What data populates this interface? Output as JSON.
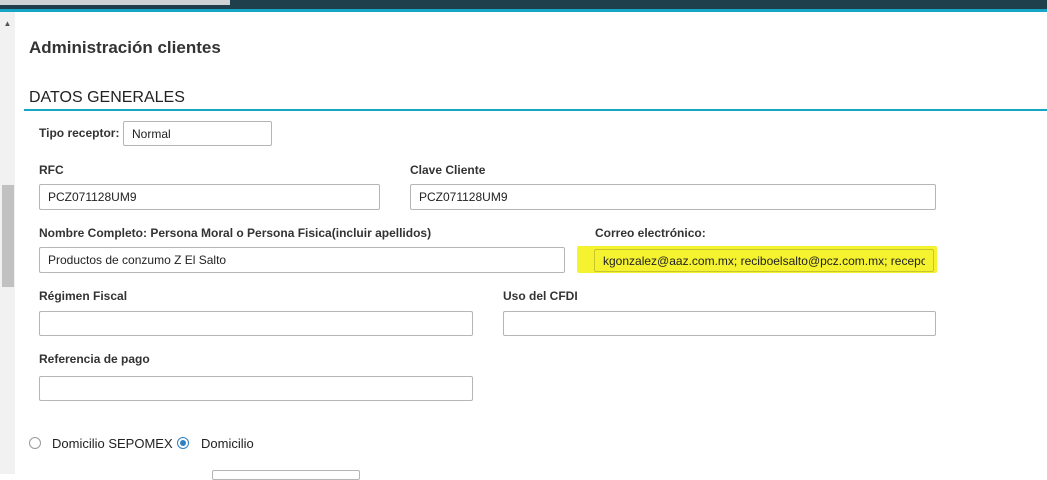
{
  "page": {
    "title": "Administración clientes",
    "section_title": "DATOS GENERALES"
  },
  "form": {
    "tipo_receptor": {
      "label": "Tipo receptor:",
      "value": "Normal"
    },
    "rfc": {
      "label": "RFC",
      "value": "PCZ071128UM9"
    },
    "clave_cliente": {
      "label": "Clave Cliente",
      "value": "PCZ071128UM9"
    },
    "nombre_completo": {
      "label": "Nombre Completo: Persona Moral o Persona Fisica(incluir apellidos)",
      "value": "Productos de conzumo Z El Salto"
    },
    "correo": {
      "label": "Correo electrónico:",
      "value": "kgonzalez@aaz.com.mx; reciboelsalto@pcz.com.mx; recepci"
    },
    "regimen_fiscal": {
      "label": "Régimen Fiscal",
      "value": ""
    },
    "uso_cfdi": {
      "label": "Uso del CFDI",
      "value": ""
    },
    "referencia_pago": {
      "label": "Referencia de pago",
      "value": ""
    }
  },
  "domicilio": {
    "options": [
      {
        "label": "Domicilio SEPOMEX",
        "selected": false
      },
      {
        "label": "Domicilio",
        "selected": true
      }
    ]
  },
  "colors": {
    "accent": "#14a6c4",
    "topbar": "#1f3f4d",
    "highlight": "#f5f230",
    "radio_selected": "#2f7fc5"
  },
  "icons": {
    "scroll_up": "triangle-up-icon"
  }
}
